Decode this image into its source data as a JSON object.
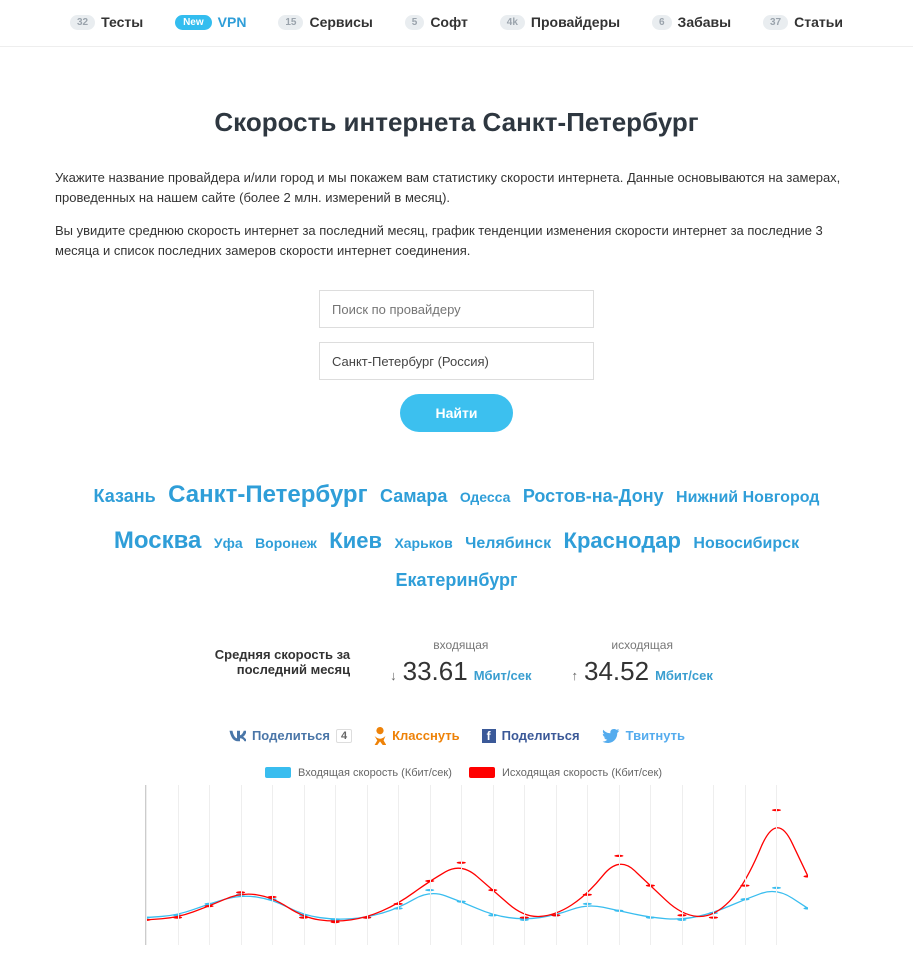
{
  "nav": [
    {
      "badge_type": "count",
      "badge": "32",
      "label": "Тесты"
    },
    {
      "badge_type": "new",
      "badge": "New",
      "label": "VPN",
      "active": true
    },
    {
      "badge_type": "count",
      "badge": "15",
      "label": "Сервисы"
    },
    {
      "badge_type": "count",
      "badge": "5",
      "label": "Софт"
    },
    {
      "badge_type": "count",
      "badge": "4k",
      "label": "Провайдеры"
    },
    {
      "badge_type": "count",
      "badge": "6",
      "label": "Забавы"
    },
    {
      "badge_type": "count",
      "badge": "37",
      "label": "Статьи"
    }
  ],
  "page": {
    "title": "Скорость интернета Санкт-Петербург",
    "desc1": "Укажите название провайдера и/или город и мы покажем вам статистику скорости интернета. Данные основываются на замерах, проведенных на нашем сайте (более 2 млн. измерений в месяц).",
    "desc2": "Вы увидите среднюю скорость интернет за последний месяц, график тенденции изменения скорости интернет за последние 3 месяца и список последних замеров скорости интернет соединения."
  },
  "form": {
    "provider_placeholder": "Поиск по провайдеру",
    "city_value": "Санкт-Петербург (Россия)",
    "find_label": "Найти"
  },
  "cloud": [
    {
      "t": "Казань",
      "s": 3
    },
    {
      "t": "Санкт-Петербург",
      "s": 5
    },
    {
      "t": "Самара",
      "s": 3
    },
    {
      "t": "Одесса",
      "s": 1
    },
    {
      "t": "Ростов-на-Дону",
      "s": 3
    },
    {
      "t": "Нижний Новгород",
      "s": 2
    },
    {
      "t": "Москва",
      "s": 5
    },
    {
      "t": "Уфа",
      "s": 1
    },
    {
      "t": "Воронеж",
      "s": 1
    },
    {
      "t": "Киев",
      "s": 4
    },
    {
      "t": "Харьков",
      "s": 1
    },
    {
      "t": "Челябинск",
      "s": 2
    },
    {
      "t": "Краснодар",
      "s": 4
    },
    {
      "t": "Новосибирск",
      "s": 2
    },
    {
      "t": "Екатеринбург",
      "s": 3
    }
  ],
  "avg": {
    "label": "Средняя скорость за последний месяц",
    "in_label": "входящая",
    "in_value": "33.61",
    "out_label": "исходящая",
    "out_value": "34.52",
    "unit": "Мбит/сек"
  },
  "share": {
    "vk_label": "Поделиться",
    "vk_count": "4",
    "ok_label": "Класснуть",
    "fb_label": "Поделиться",
    "tw_label": "Твитнуть"
  },
  "chart_data": {
    "type": "line",
    "title": "",
    "xlabel": "",
    "ylabel": "Кбит/сек",
    "ylim": [
      38000,
      45000
    ],
    "y_ticks": [
      40000,
      45000
    ],
    "x_count": 22,
    "series": [
      {
        "name": "Входящая скорость (Кбит/сек)",
        "color": "#39bdef",
        "values": [
          39200,
          39300,
          39800,
          40200,
          40000,
          39300,
          39100,
          39200,
          39600,
          40400,
          39900,
          39300,
          39100,
          39300,
          39800,
          39500,
          39200,
          39100,
          39400,
          40000,
          40500,
          39600
        ]
      },
      {
        "name": "Исходящая скорость (Кбит/сек)",
        "color": "#ff0000",
        "values": [
          39100,
          39200,
          39700,
          40300,
          40100,
          39200,
          39000,
          39200,
          39800,
          40800,
          41600,
          40400,
          39200,
          39300,
          40200,
          41900,
          40600,
          39300,
          39200,
          40600,
          43900,
          41000
        ]
      }
    ]
  }
}
